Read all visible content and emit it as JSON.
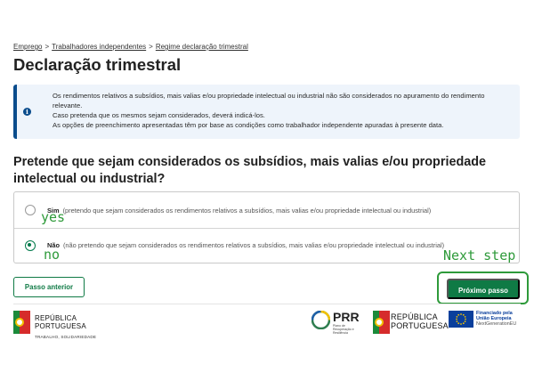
{
  "breadcrumb": {
    "items": [
      "Emprego",
      "Trabalhadores independentes",
      "Regime declaração trimestral"
    ],
    "separator": ">"
  },
  "page_title": "Declaração trimestral",
  "info": {
    "icon": "info-icon",
    "line1": "Os rendimentos relativos a subsídios, mais valias e/ou propriedade intelectual ou industrial não são considerados no apuramento do rendimento",
    "line2": "relevante.",
    "line3": "Caso pretenda que os mesmos sejam considerados, deverá indicá-los.",
    "line4": "As opções de preenchimento apresentadas têm por base as condições como trabalhador independente apuradas à presente data."
  },
  "question": "Pretende que sejam considerados os subsídios, mais valias e/ou propriedade intelectual ou industrial?",
  "options": [
    {
      "title": "Sim",
      "detail": "(pretendo que sejam considerados os rendimentos relativos a subsídios, mais valias e/ou propriedade intelectual ou industrial)",
      "selected": false
    },
    {
      "title": "Não",
      "detail": "(não pretendo que sejam considerados os rendimentos relativos a subsídios, mais valias e/ou propriedade intelectual ou industrial)",
      "selected": true
    }
  ],
  "annotations": {
    "yes": "yes",
    "no": "no",
    "next_step": "Next step"
  },
  "buttons": {
    "previous": "Passo anterior",
    "next": "Próximo passo"
  },
  "footer": {
    "rp_line1": "REPÚBLICA",
    "rp_line2": "PORTUGUESA",
    "rp_sub": "TRABALHO, SOLIDARIEDADE",
    "prr_title": "PRR",
    "prr_sub": "Plano de Recuperação e Resiliência",
    "rp2_line1": "REPÚBLICA",
    "rp2_line2": "PORTUGUESA",
    "eu_line1": "Financiado pela",
    "eu_line2": "União Europeia",
    "eu_line3": "NextGenerationEU"
  },
  "colors": {
    "accent_green": "#0f7a45",
    "info_blue": "#0a4c8c",
    "annotation_green": "#2e9a3a"
  }
}
